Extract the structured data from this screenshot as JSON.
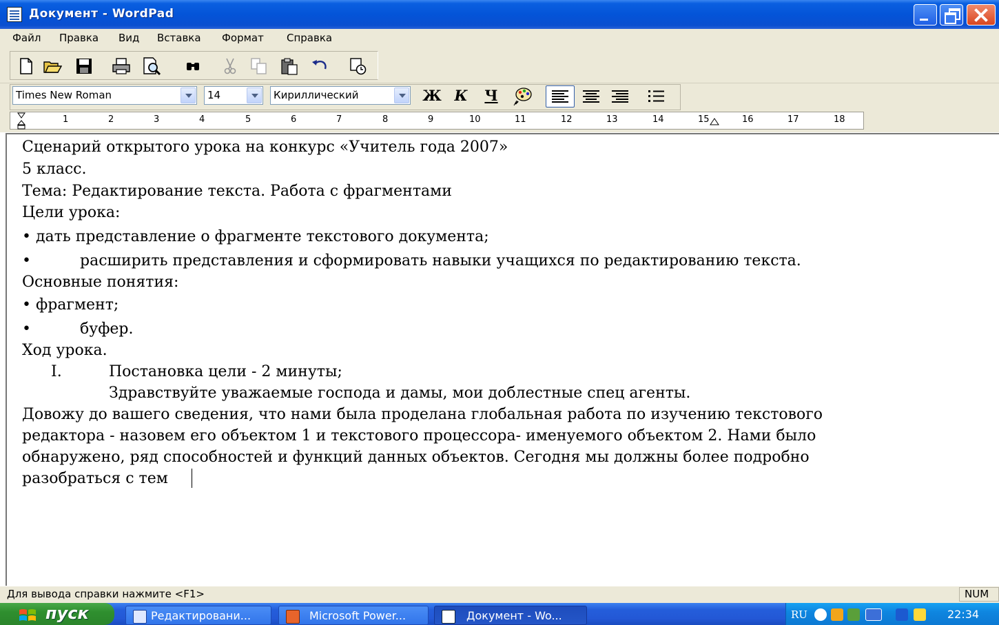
{
  "window": {
    "title": "Документ - WordPad"
  },
  "menu": [
    "Файл",
    "Правка",
    "Вид",
    "Вставка",
    "Формат",
    "Справка"
  ],
  "toolbar": {
    "icons": [
      "new-document-icon",
      "open-folder-icon",
      "save-icon",
      "print-icon",
      "print-preview-icon",
      "find-icon",
      "cut-icon",
      "copy-icon",
      "paste-icon",
      "undo-icon",
      "insert-datetime-icon"
    ]
  },
  "format_bar": {
    "font": "Times New Roman",
    "size": "14",
    "script": "Кириллический",
    "bold": "Ж",
    "italic": "К",
    "underline": "Ч",
    "alignment_selected": "left"
  },
  "ruler": {
    "marks": [
      "1",
      "2",
      "3",
      "4",
      "5",
      "6",
      "7",
      "8",
      "9",
      "10",
      "11",
      "12",
      "13",
      "14",
      "15",
      "16",
      "17",
      "18"
    ]
  },
  "document": {
    "lines": [
      "Сценарий открытого урока на конкурс «Учитель года 2007»",
      "5 класс.",
      "Тема: Редактирование текста. Работа с фрагментами",
      "Цели урока:",
      "• дать представление о фрагменте текстового документа;",
      "•",
      "расширить представления и сформировать навыки учащихся по редактированию текста.",
      "Основные понятия:",
      "• фрагмент;",
      "•",
      "буфер.",
      "Ход урока.",
      "I.",
      "Постановка цели - 2 минуты;",
      "Здравствуйте уважаемые господа и дамы, мои доблестные спец агенты.",
      "Довожу до вашего сведения, что нами была проделана глобальная работа по изучению текстового",
      "редактора - назовем его объектом 1 и текстового процессора- именуемого объектом 2. Нами было",
      "обнаружено, ряд способностей и функций данных объектов. Сегодня мы должны более подробно",
      "разобраться с тем"
    ]
  },
  "status": {
    "help": "Для вывода справки нажмите <F1>",
    "num": "NUM"
  },
  "taskbar": {
    "start": "пуск",
    "tasks": [
      "Редактировани...",
      "Microsoft Power...",
      "Документ - Wo..."
    ],
    "lang": "RU",
    "clock": "22:34"
  },
  "colors": {
    "titlebar": "#0454d8",
    "chrome": "#ece9d8",
    "taskbar": "#245edb",
    "start": "#2f8f2f"
  }
}
